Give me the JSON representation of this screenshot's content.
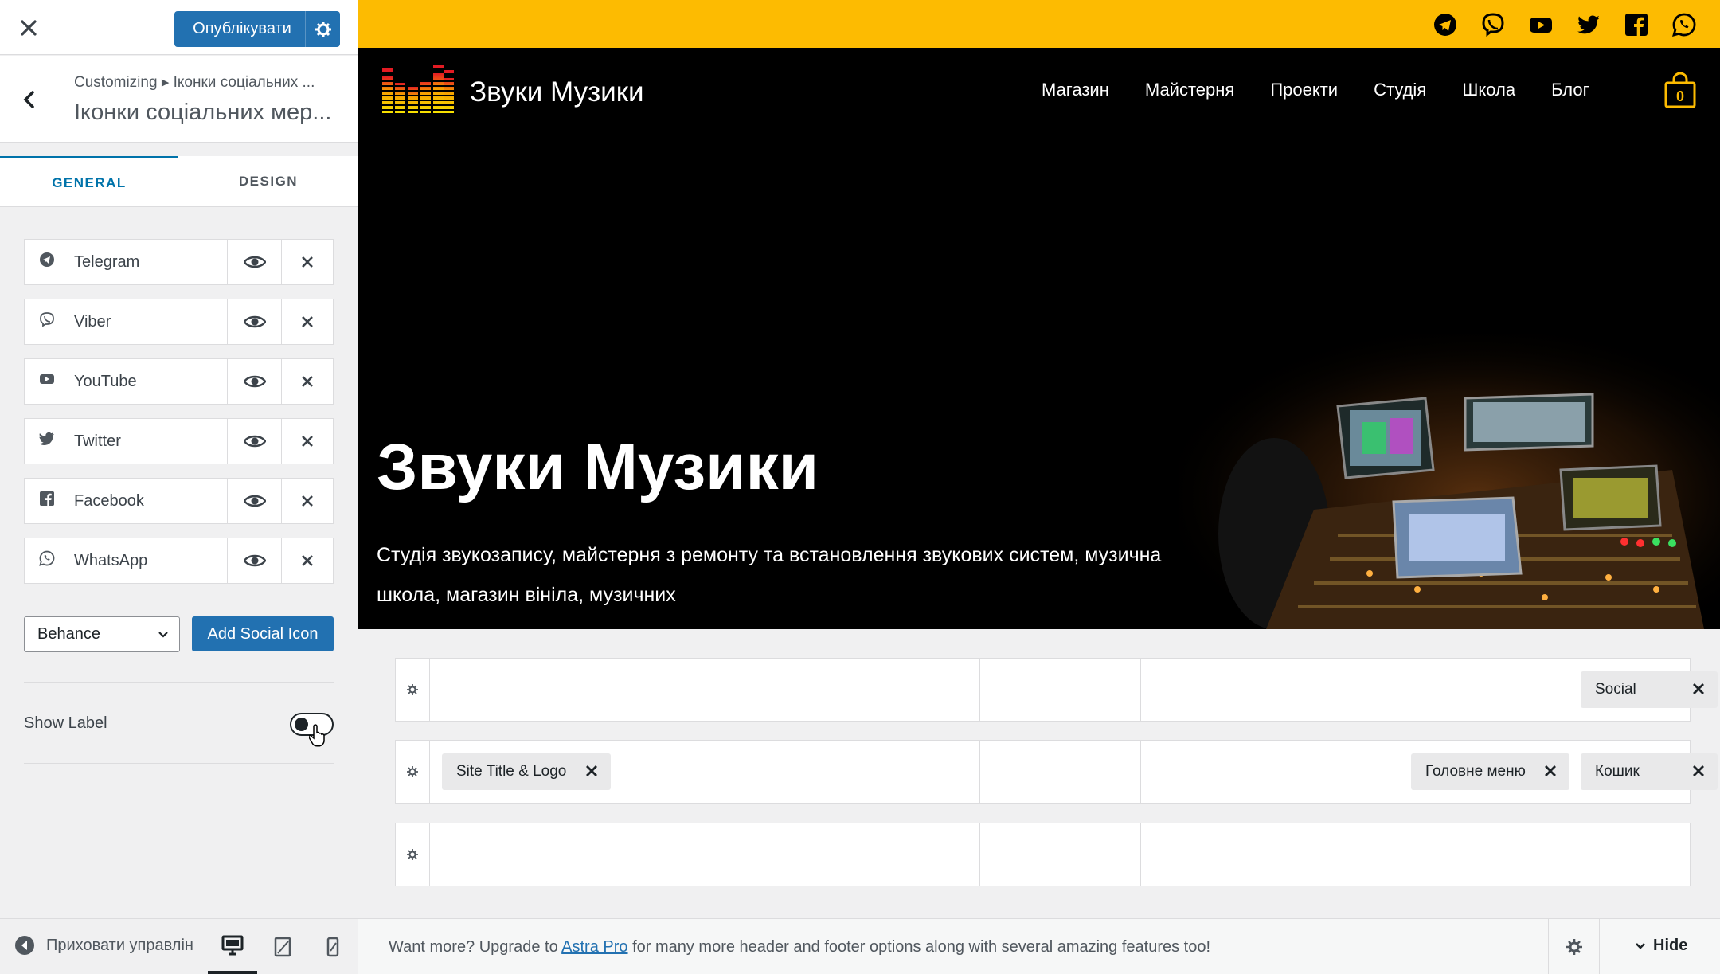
{
  "customizer": {
    "publish_label": "Опублікувати",
    "breadcrumb": "Customizing ▸ Іконки соціальних ...",
    "section_title": "Іконки соціальних мер...",
    "tabs": [
      "GENERAL",
      "DESIGN"
    ],
    "social_items": [
      {
        "label": "Telegram",
        "icon": "telegram-icon"
      },
      {
        "label": "Viber",
        "icon": "viber-icon"
      },
      {
        "label": "YouTube",
        "icon": "youtube-icon"
      },
      {
        "label": "Twitter",
        "icon": "twitter-icon"
      },
      {
        "label": "Facebook",
        "icon": "facebook-icon"
      },
      {
        "label": "WhatsApp",
        "icon": "whatsapp-icon"
      }
    ],
    "select_value": "Behance",
    "add_button": "Add Social Icon",
    "show_label": "Show Label",
    "show_label_on": false,
    "hide_controls": "Приховати управлін"
  },
  "site": {
    "title": "Звуки Музики",
    "nav": [
      "Магазин",
      "Майстерня",
      "Проекти",
      "Студія",
      "Школа",
      "Блог"
    ],
    "cart_count": "0",
    "hero_title": "Звуки Музики",
    "hero_subtitle": "Студія звукозапису, майстерня з ремонту та встановлення звукових систем, музична школа, магазин вініла, музичних",
    "topbar_icons": [
      "telegram-icon",
      "viber-icon",
      "youtube-icon",
      "twitter-icon",
      "facebook-icon",
      "whatsapp-icon"
    ]
  },
  "header_builder": {
    "row1_chips": [
      "Social"
    ],
    "row2_left_chip": "Site Title & Logo",
    "row2_right_chips": [
      "Головне меню",
      "Кошик"
    ],
    "upgrade_prefix": "Want more? Upgrade to ",
    "upgrade_link": "Astra Pro",
    "upgrade_suffix": " for many more header and footer options along with several amazing features too!",
    "hide_label": "Hide"
  },
  "colors": {
    "accent": "#2271b1",
    "topbar": "#fdbb01",
    "header_bg": "#000000"
  }
}
